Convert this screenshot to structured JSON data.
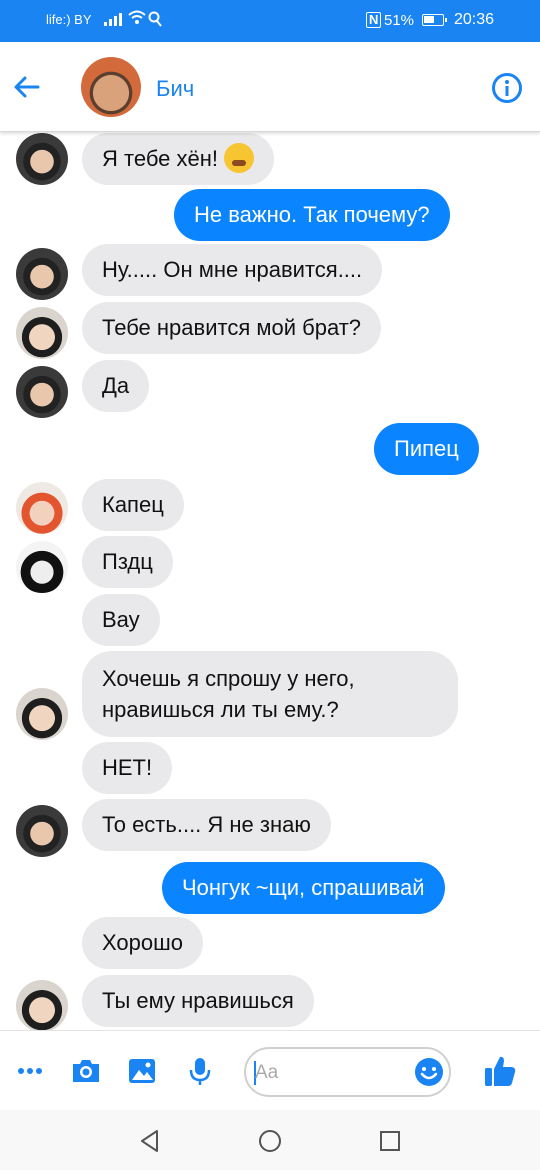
{
  "status_bar": {
    "carrier": "life:) BY",
    "battery": "51%",
    "time": "20:36",
    "nfc_label": "N"
  },
  "header": {
    "contact_name": "Бич",
    "back_icon": "arrow-left-icon",
    "info_icon": "info-icon"
  },
  "messages": [
    {
      "direction": "in",
      "text": "Я тебе хён!",
      "emoji": "tired-face-emoji"
    },
    {
      "direction": "out",
      "text": "Не важно. Так почему?"
    },
    {
      "direction": "in",
      "text": "Ну..... Он мне нравится...."
    },
    {
      "direction": "in",
      "text": "Тебе нравится мой брат?"
    },
    {
      "direction": "in",
      "text": "Да"
    },
    {
      "direction": "out",
      "text": "Пипец"
    },
    {
      "direction": "in",
      "text": "Капец"
    },
    {
      "direction": "in",
      "text": "Пздц"
    },
    {
      "direction": "in",
      "text": "Вау"
    },
    {
      "direction": "in",
      "text": "Хочешь я спрошу у него, нравишься ли ты ему.?"
    },
    {
      "direction": "in",
      "text": "НЕТ!"
    },
    {
      "direction": "in",
      "text": "То есть.... Я не знаю"
    },
    {
      "direction": "out",
      "text": "Чонгук ~щи, спрашивай"
    },
    {
      "direction": "in",
      "text": "Хорошо"
    },
    {
      "direction": "in",
      "text": "Ты ему нравишься"
    }
  ],
  "composer": {
    "placeholder": "Aa",
    "icons": [
      "more-icon",
      "camera-icon",
      "image-icon",
      "microphone-icon",
      "emoji-icon",
      "like-icon"
    ]
  },
  "colors": {
    "accent": "#1a84f2",
    "outgoing_bubble": "#0a84ff",
    "incoming_bubble": "#e9e9eb"
  }
}
